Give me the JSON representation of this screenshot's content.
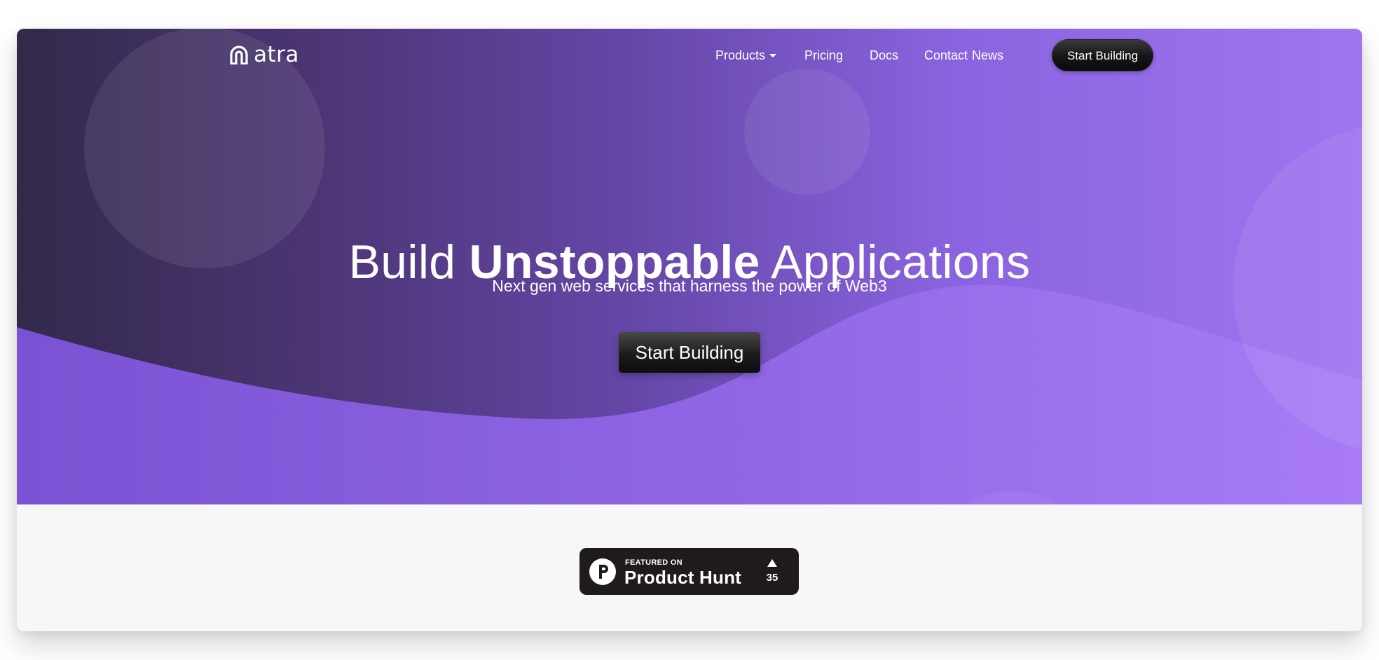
{
  "nav": {
    "logo_text": "atra",
    "items": [
      {
        "label": "Products"
      },
      {
        "label": "Pricing"
      },
      {
        "label": "Docs"
      },
      {
        "label": "Contact"
      },
      {
        "label": "News"
      }
    ],
    "cta_label": "Start Building"
  },
  "hero": {
    "headline_start": "Build ",
    "headline_bold": "Unstoppable",
    "headline_end": " Applications",
    "subheadline": "Next gen web services that harness the power of Web3",
    "cta_label": "Start Building"
  },
  "badge": {
    "featured_on": "FEATURED ON",
    "name": "Product Hunt",
    "upvotes": "35"
  },
  "colors": {
    "gradient_start": "#32294a",
    "gradient_end": "#a174f0",
    "button_dark": "#111111",
    "footer_bg": "#f7f7f7",
    "badge_bg": "#1f1b1c"
  },
  "icons": {
    "logo": "atra-logo-icon",
    "dropdown": "caret-down-icon",
    "product_hunt": "product-hunt-icon",
    "upvote": "upvote-triangle-icon"
  }
}
